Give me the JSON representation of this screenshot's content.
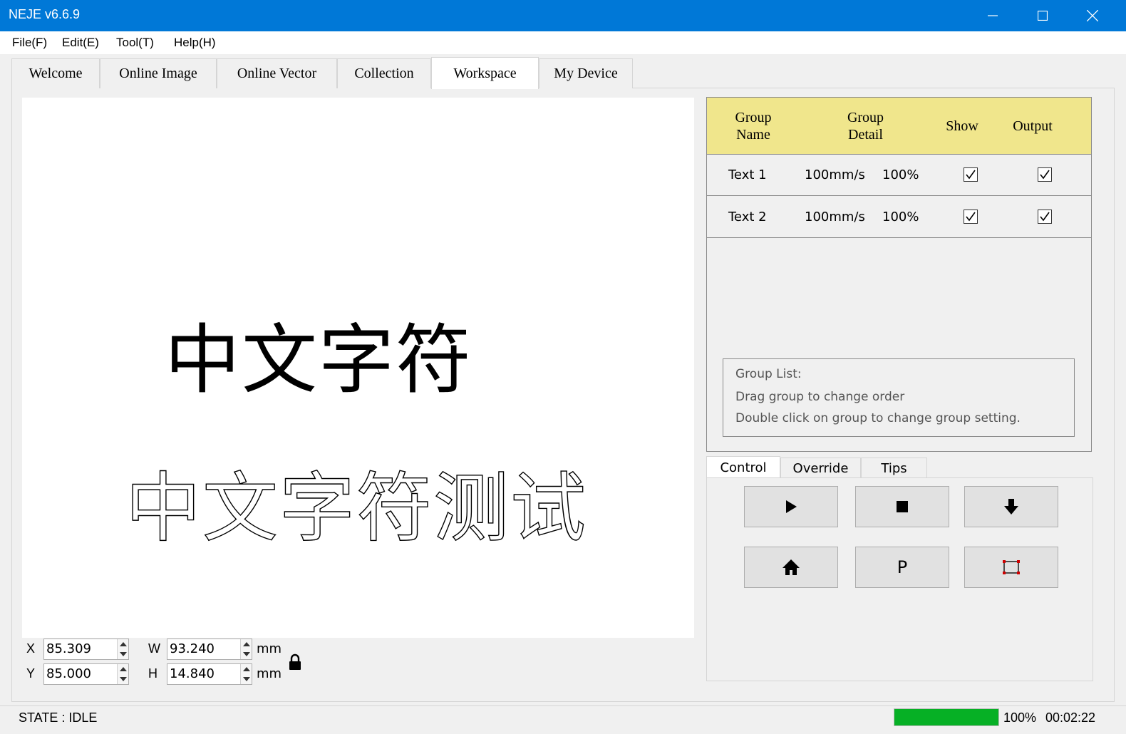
{
  "window": {
    "title": "NEJE v6.6.9"
  },
  "menu": [
    "File(F)",
    "Edit(E)",
    "Tool(T)",
    "Help(H)"
  ],
  "tabs": [
    {
      "label": "Welcome"
    },
    {
      "label": "Online Image"
    },
    {
      "label": "Online Vector"
    },
    {
      "label": "Collection"
    },
    {
      "label": "Workspace",
      "active": true
    },
    {
      "label": "My Device"
    }
  ],
  "canvas": {
    "text_solid": "中文字符",
    "text_outline": "中文字符测试"
  },
  "position": {
    "x_label": "X",
    "x_value": "85.309",
    "y_label": "Y",
    "y_value": "85.000",
    "w_label": "W",
    "w_value": "93.240",
    "h_label": "H",
    "h_value": "14.840",
    "unit": "mm",
    "lock_icon": "lock-icon"
  },
  "group_table": {
    "headers": {
      "name_line1": "Group",
      "name_line2": "Name",
      "detail_line1": "Group",
      "detail_line2": "Detail",
      "show": "Show",
      "output": "Output"
    },
    "header_color": "#f0e68c",
    "rows": [
      {
        "name": "Text 1",
        "speed": "100mm/s",
        "power": "100%",
        "show": true,
        "output": true
      },
      {
        "name": "Text 2",
        "speed": "100mm/s",
        "power": "100%",
        "show": true,
        "output": true
      }
    ],
    "hint": {
      "line1": "Group List:",
      "line2": "Drag group to change order",
      "line3": "Double click on group to change group setting."
    }
  },
  "control_tabs": [
    {
      "label": "Control",
      "active": true
    },
    {
      "label": "Override"
    },
    {
      "label": "Tips"
    }
  ],
  "control_buttons": {
    "p_label": "P",
    "icons": [
      "play-icon",
      "stop-icon",
      "arrow-down-icon",
      "home-icon",
      "frame-icon"
    ]
  },
  "status": {
    "state": "STATE : IDLE",
    "progress": 1.0,
    "progress_label": "100%",
    "elapsed": "00:02:22",
    "progress_color": "#06b025"
  }
}
